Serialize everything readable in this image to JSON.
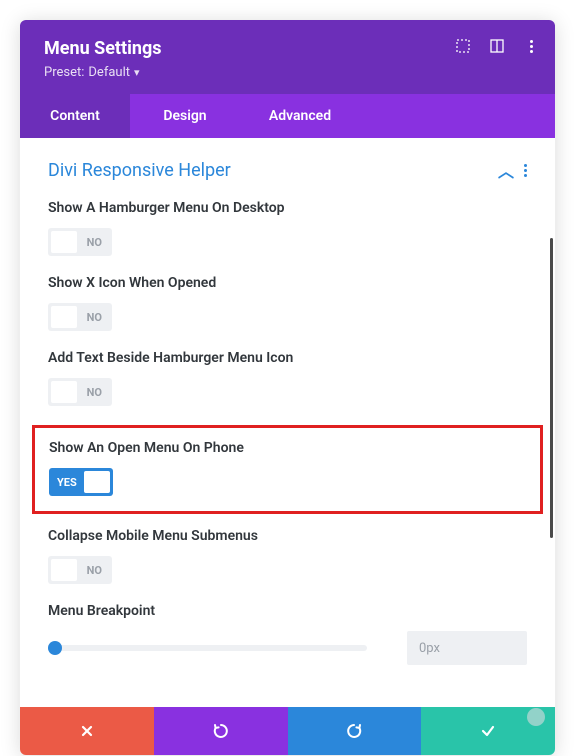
{
  "header": {
    "title": "Menu Settings",
    "preset_label": "Preset:",
    "preset_value": "Default"
  },
  "tabs": {
    "content": "Content",
    "design": "Design",
    "advanced": "Advanced"
  },
  "section": {
    "title": "Divi Responsive Helper"
  },
  "options": {
    "hamburger_desktop": {
      "label": "Show A Hamburger Menu On Desktop",
      "value": "NO"
    },
    "x_icon": {
      "label": "Show X Icon When Opened",
      "value": "NO"
    },
    "text_beside": {
      "label": "Add Text Beside Hamburger Menu Icon",
      "value": "NO"
    },
    "open_phone": {
      "label": "Show An Open Menu On Phone",
      "value": "YES"
    },
    "collapse_submenus": {
      "label": "Collapse Mobile Menu Submenus",
      "value": "NO"
    },
    "breakpoint": {
      "label": "Menu Breakpoint",
      "value": "0px"
    }
  }
}
